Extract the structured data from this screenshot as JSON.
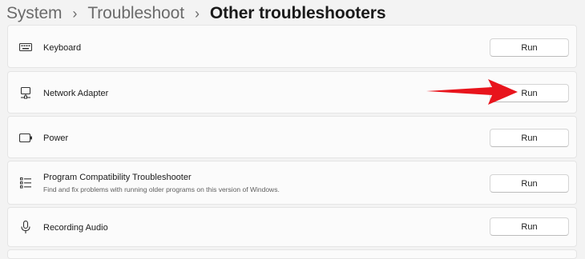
{
  "breadcrumb": {
    "items": [
      "System",
      "Troubleshoot",
      "Other troubleshooters"
    ],
    "separator": "›"
  },
  "troubleshooters": [
    {
      "title": "Keyboard",
      "icon": "keyboard-icon",
      "button": "Run"
    },
    {
      "title": "Network Adapter",
      "icon": "network-adapter-icon",
      "button": "Run"
    },
    {
      "title": "Power",
      "icon": "battery-icon",
      "button": "Run"
    },
    {
      "title": "Program Compatibility Troubleshooter",
      "subtitle": "Find and fix problems with running older programs on this version of Windows.",
      "icon": "list-icon",
      "button": "Run"
    },
    {
      "title": "Recording Audio",
      "icon": "microphone-icon",
      "button": "Run"
    }
  ],
  "annotation": {
    "icon": "red-arrow-icon",
    "color": "#e8141c"
  },
  "colors": {
    "page_bg": "#f3f3f3",
    "card_bg": "#fbfbfb",
    "button_bg": "#ffffff"
  }
}
